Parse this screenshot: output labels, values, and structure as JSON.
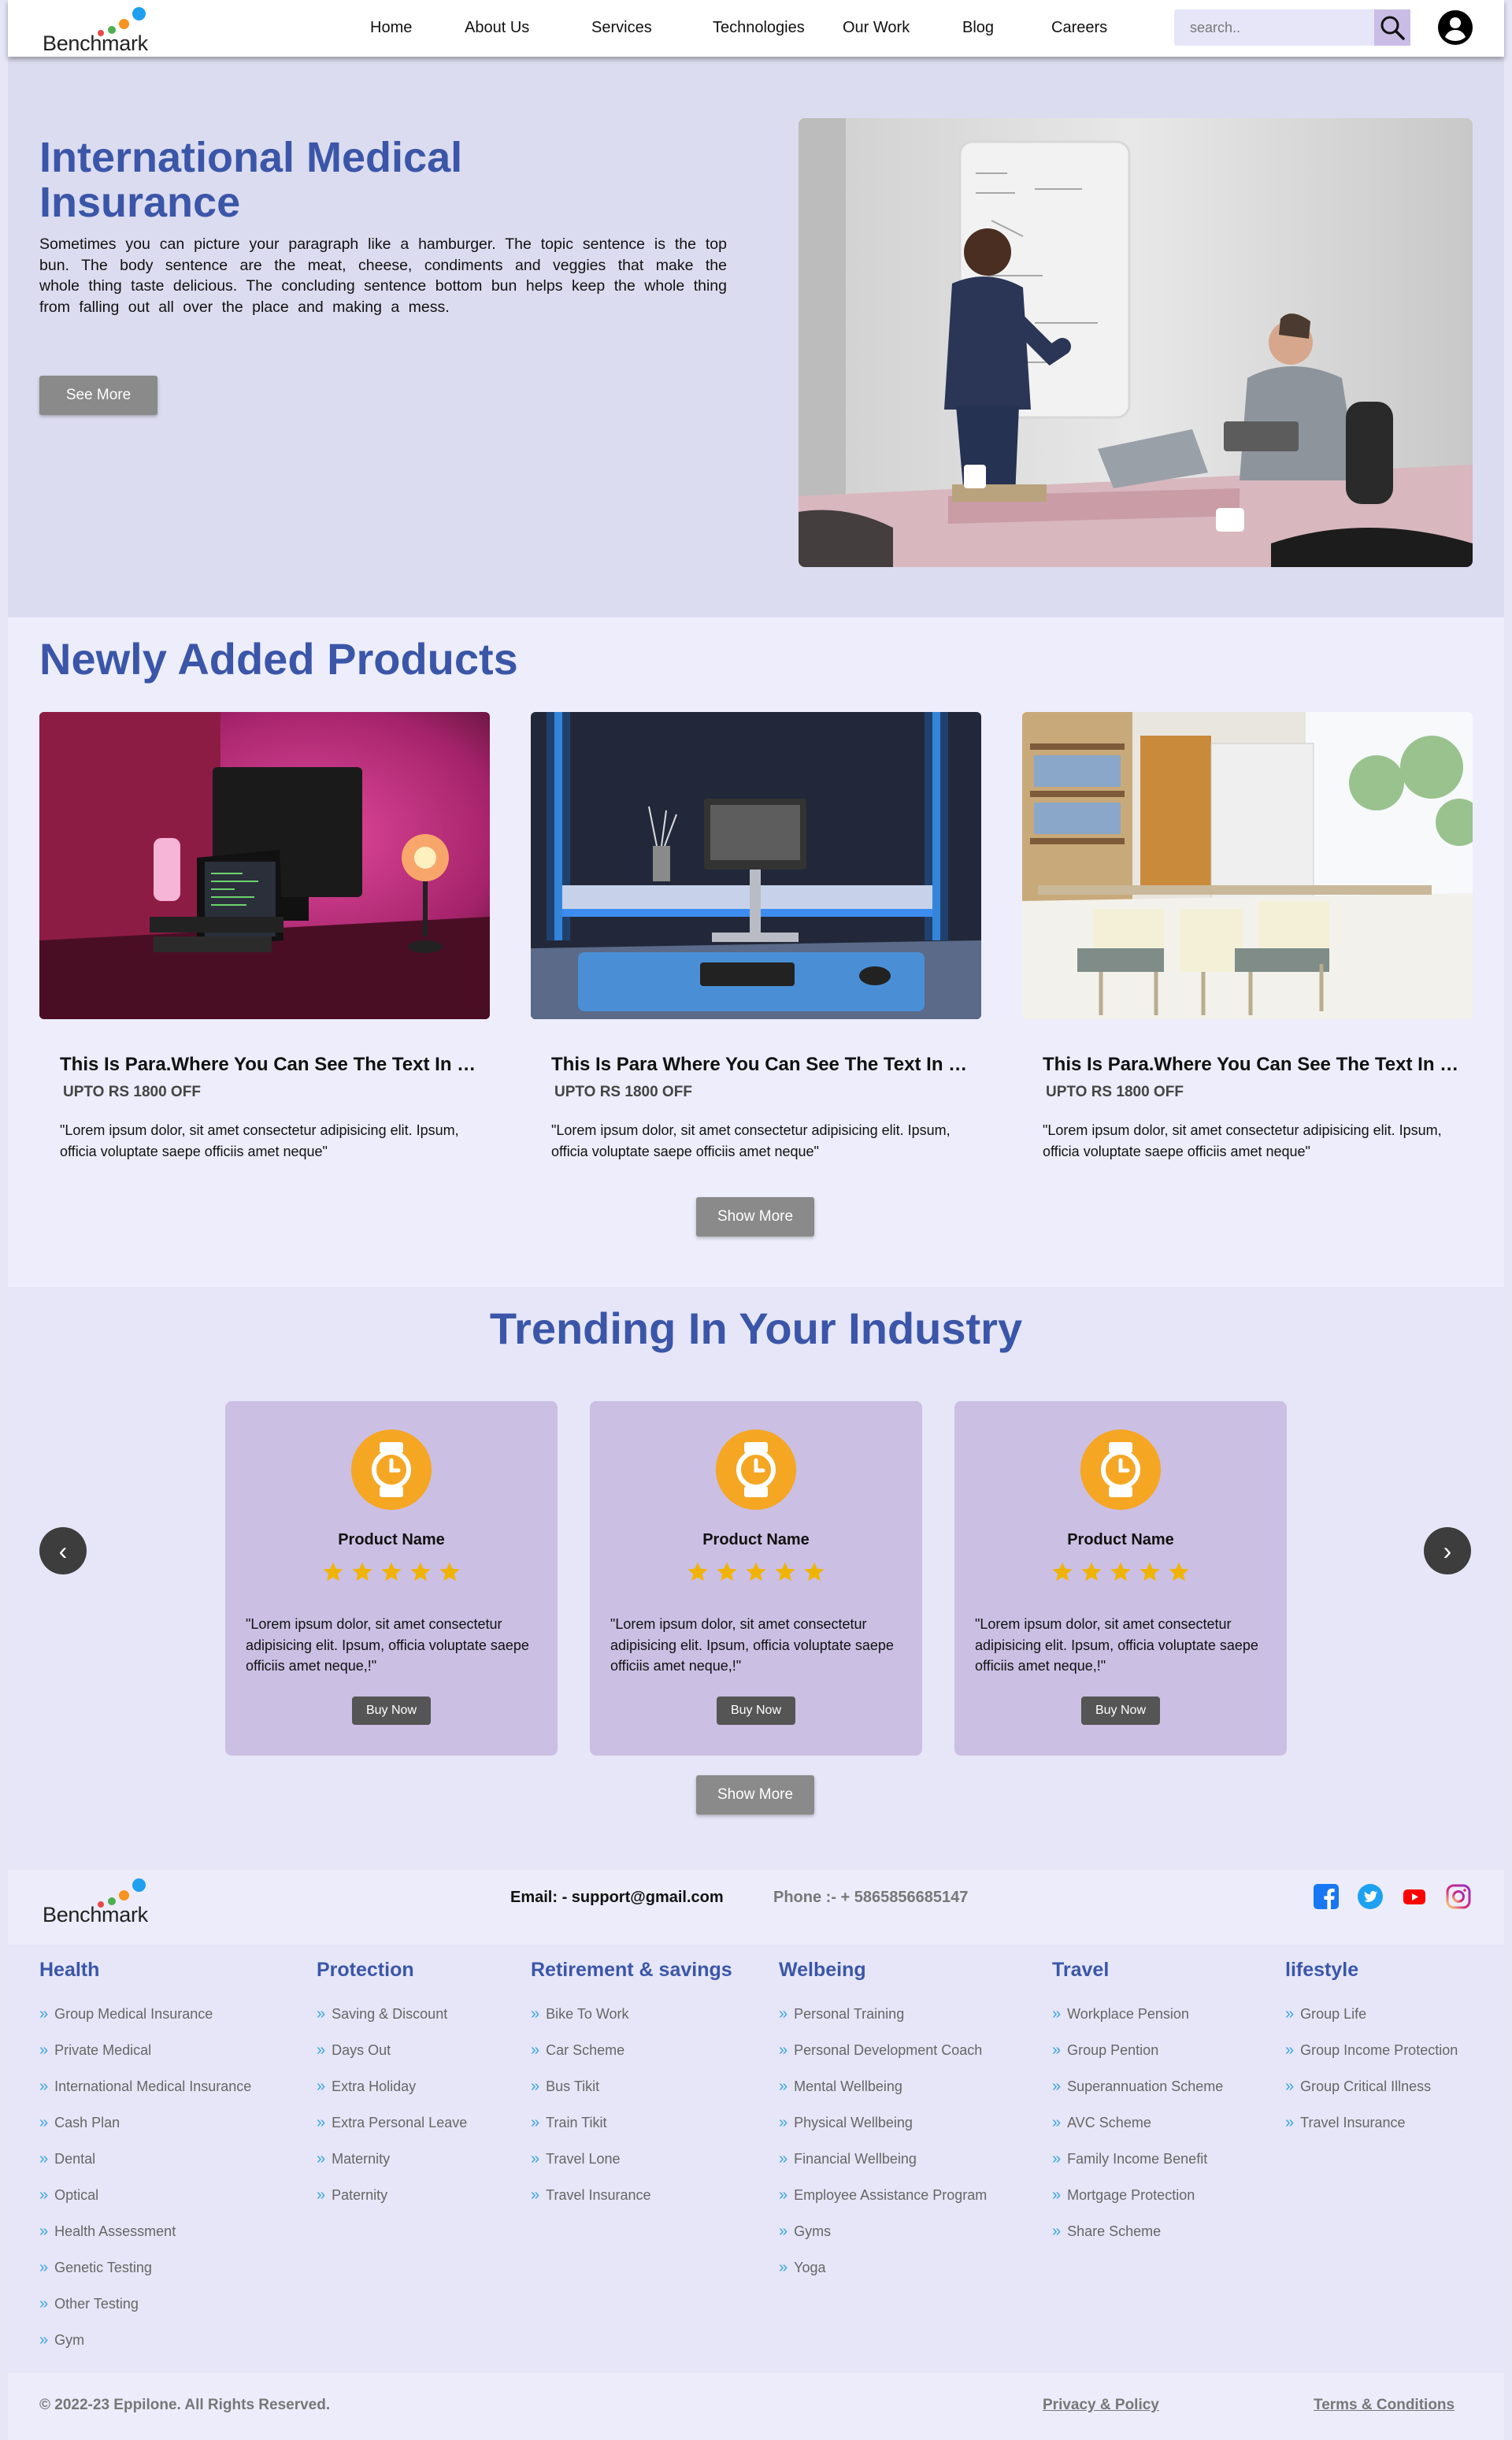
{
  "header": {
    "logo_text": "Benchmark",
    "nav": [
      "Home",
      "About Us",
      "Services",
      "Technologies",
      "Our Work",
      "Blog",
      "Careers"
    ],
    "search_placeholder": "search..",
    "search_icon": "search-icon",
    "user_icon": "user-account-icon"
  },
  "hero": {
    "title": "International Medical Insurance",
    "paragraph": "Sometimes you can picture your paragraph like a hamburger. The topic sentence is the top bun. The body sentence are the meat, cheese, condiments and veggies that make the whole thing taste delicious. The concluding sentence bottom bun helps keep the whole thing from falling out all over the place and making a mess.",
    "button": "See More"
  },
  "products": {
    "heading": "Newly Added Products",
    "items": [
      {
        "title": "This Is Para.Where You Can See The Text In Card",
        "offer": "UPTO RS 1800 OFF",
        "desc": "\"Lorem ipsum dolor, sit amet consectetur adipisicing elit. Ipsum, officia voluptate saepe officiis amet neque\""
      },
      {
        "title": "This Is Para Where You Can See The Text In Card",
        "offer": "UPTO RS 1800 OFF",
        "desc": "\"Lorem ipsum dolor, sit amet consectetur adipisicing elit. Ipsum, officia voluptate saepe officiis amet neque\""
      },
      {
        "title": "This Is Para.Where You Can See The Text In Card",
        "offer": "UPTO RS 1800 OFF",
        "desc": "\"Lorem ipsum dolor, sit amet consectetur adipisicing elit. Ipsum, officia voluptate saepe officiis amet neque\""
      }
    ],
    "show_more": "Show More"
  },
  "trending": {
    "heading": "Trending In Your Industry",
    "icon": "watch-icon",
    "items": [
      {
        "name": "Product Name",
        "rating": 5,
        "desc": "\"Lorem ipsum dolor, sit amet consectetur adipisicing elit. Ipsum, officia voluptate saepe officiis amet neque,!\"",
        "buy": "Buy Now"
      },
      {
        "name": "Product Name",
        "rating": 5,
        "desc": "\"Lorem ipsum dolor, sit amet consectetur adipisicing elit. Ipsum, officia voluptate saepe officiis amet neque,!\"",
        "buy": "Buy Now"
      },
      {
        "name": "Product Name",
        "rating": 5,
        "desc": "\"Lorem ipsum dolor, sit amet consectetur adipisicing elit. Ipsum, officia voluptate saepe officiis amet neque,!\"",
        "buy": "Buy Now"
      }
    ],
    "prev": "‹",
    "next": "›",
    "show_more": "Show More"
  },
  "footer": {
    "logo_text": "Benchmark",
    "email": "Email: - support@gmail.com",
    "phone": "Phone :- + 5865856685147",
    "social": [
      "facebook-icon",
      "twitter-icon",
      "youtube-icon",
      "instagram-icon"
    ],
    "columns": [
      {
        "heading": "Health",
        "items": [
          "Group Medical Insurance",
          "Private Medical",
          "International Medical Insurance",
          "Cash Plan",
          "Dental",
          "Optical",
          "Health Assessment",
          "Genetic Testing",
          "Other Testing",
          "Gym"
        ]
      },
      {
        "heading": "Protection",
        "items": [
          "Saving & Discount",
          "Days Out",
          "Extra Holiday",
          "Extra Personal Leave",
          "Maternity",
          "Paternity"
        ]
      },
      {
        "heading": "Retirement & savings",
        "items": [
          "Bike To Work",
          "Car Scheme",
          "Bus Tikit",
          "Train Tikit",
          "Travel Lone",
          "Travel Insurance"
        ]
      },
      {
        "heading": "Welbeing",
        "items": [
          "Personal Training",
          "Personal Development Coach",
          "Mental Wellbeing",
          "Physical Wellbeing",
          "Financial Wellbeing",
          "Employee Assistance Program",
          "Gyms",
          "Yoga"
        ]
      },
      {
        "heading": "Travel",
        "items": [
          "Workplace Pension",
          "Group Pention",
          "Superannuation Scheme",
          "AVC Scheme",
          "Family Income Benefit",
          "Mortgage Protection",
          "Share Scheme"
        ]
      },
      {
        "heading": "lifestyle",
        "items": [
          "Group Life",
          "Group Income Protection",
          "Group Critical Illness",
          "Travel Insurance"
        ]
      }
    ],
    "copyright": "© 2022-23 Eppilone. All Rights Reserved.",
    "privacy": "Privacy & Policy",
    "terms": "Terms & Conditions"
  },
  "colors": {
    "accent_blue": "#3b56a8",
    "card_lilac": "#cbbfe3",
    "watch_orange": "#f5a623",
    "star_gold": "#f0b400"
  }
}
